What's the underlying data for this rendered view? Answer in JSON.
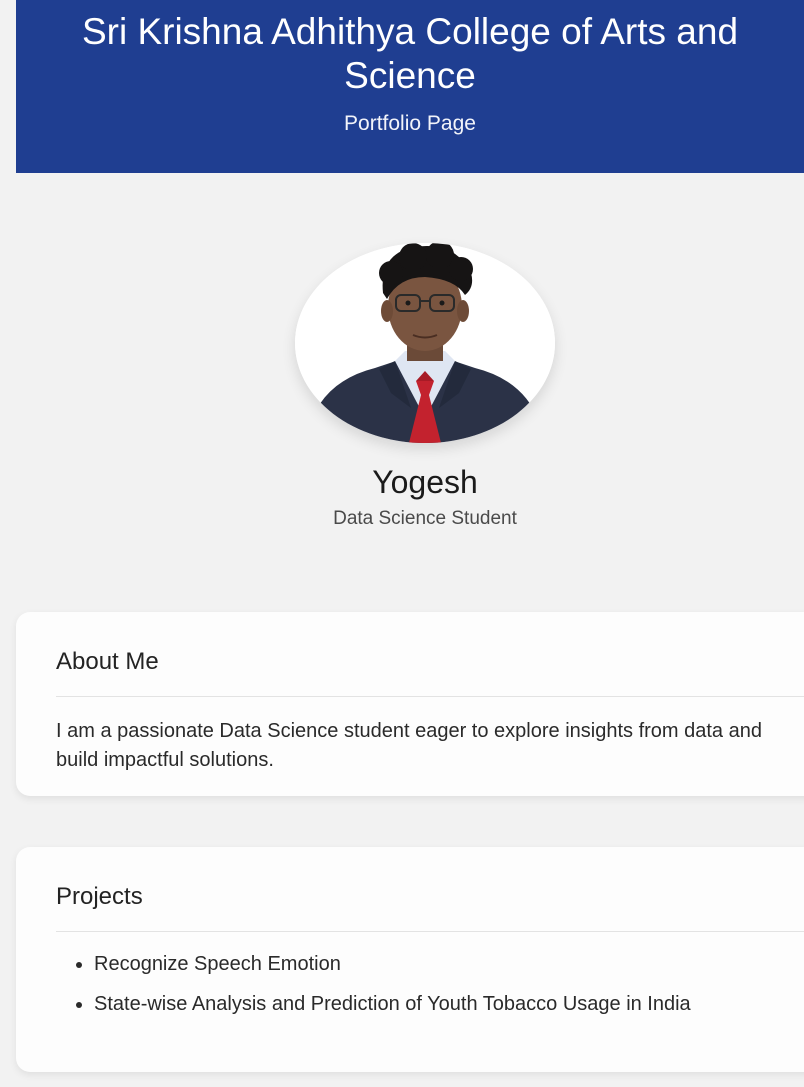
{
  "header": {
    "title": "Sri Krishna Adhithya College of Arts and Science",
    "subtitle": "Portfolio Page"
  },
  "profile": {
    "name": "Yogesh",
    "role": "Data Science Student"
  },
  "about": {
    "heading": "About Me",
    "text": "I am a passionate Data Science student eager to explore insights from data and build impactful solutions."
  },
  "projects": {
    "heading": "Projects",
    "items": [
      "Recognize Speech Emotion",
      "State-wise Analysis and Prediction of Youth Tobacco Usage in India"
    ]
  },
  "colors": {
    "header_bg": "#1f3e91",
    "page_bg": "#f2f2f2",
    "card_bg": "#fdfdfd"
  }
}
